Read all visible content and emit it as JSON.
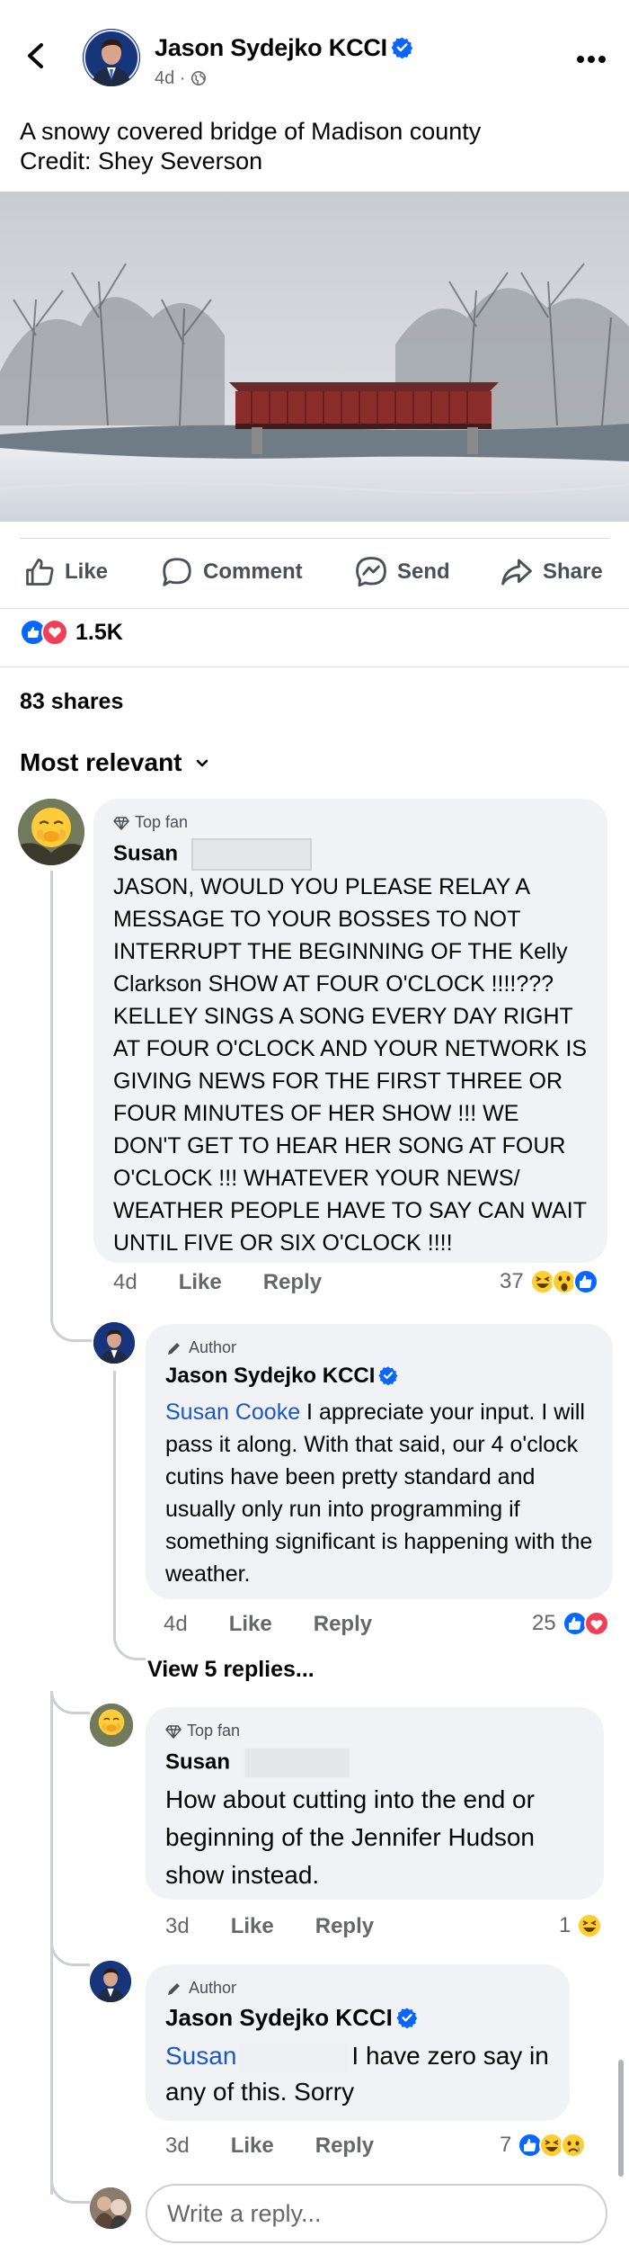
{
  "header": {
    "author": "Jason Sydejko KCCI",
    "age": "4d",
    "audience_icon": "globe-icon"
  },
  "post": {
    "caption": "A snowy covered bridge of Madison county\nCredit: Shey Severson",
    "photo_description": "snowy covered bridge"
  },
  "actions": {
    "like": "Like",
    "comment": "Comment",
    "send": "Send",
    "share": "Share"
  },
  "stats": {
    "reactions": "1.5K",
    "shares": "83 shares"
  },
  "sort": {
    "label": "Most relevant"
  },
  "comments": [
    {
      "badge": "Top fan",
      "name": "Susan",
      "text": "JASON,  WOULD YOU PLEASE RELAY A MESSAGE TO YOUR BOSSES TO NOT INTERRUPT THE BEGINNING OF THE Kelly Clarkson SHOW AT FOUR O'CLOCK !!!!??? KELLEY SINGS A SONG EVERY DAY RIGHT AT FOUR O'CLOCK AND YOUR NETWORK IS GIVING NEWS FOR THE FIRST THREE OR FOUR MINUTES OF HER SHOW !!!   WE DON'T GET TO HEAR HER SONG AT FOUR O'CLOCK !!!   WHATEVER YOUR NEWS/ WEATHER PEOPLE HAVE TO SAY CAN WAIT UNTIL FIVE OR SIX O'CLOCK !!!!",
      "age": "4d",
      "like": "Like",
      "reply": "Reply",
      "count": "37"
    },
    {
      "badge": "Author",
      "name": "Jason Sydejko KCCI",
      "mention": "Susan Cooke",
      "text": " I appreciate your input. I will pass it along. With that said, our 4 o'clock cutins have been pretty standard and usually only run into programming if something significant is happening with the weather.",
      "age": "4d",
      "like": "Like",
      "reply": "Reply",
      "count": "25"
    },
    {
      "badge": "Top fan",
      "name": "Susan",
      "text": "How about cutting into the end or beginning of the Jennifer Hudson show instead.",
      "age": "3d",
      "like": "Like",
      "reply": "Reply",
      "count": "1"
    },
    {
      "badge": "Author",
      "name": "Jason Sydejko KCCI",
      "mention": "Susan",
      "text": "I have zero say in any of this. Sorry",
      "age": "3d",
      "like": "Like",
      "reply": "Reply",
      "count": "7"
    }
  ],
  "view_replies": "View 5 replies...",
  "reply_box": {
    "placeholder": "Write a reply..."
  },
  "colors": {
    "facebook_blue": "#0866ff",
    "love_red": "#f33e58",
    "mention_blue": "#1a57c9",
    "bubble_gray": "#f0f2f5",
    "secondary_text": "#65676b"
  }
}
